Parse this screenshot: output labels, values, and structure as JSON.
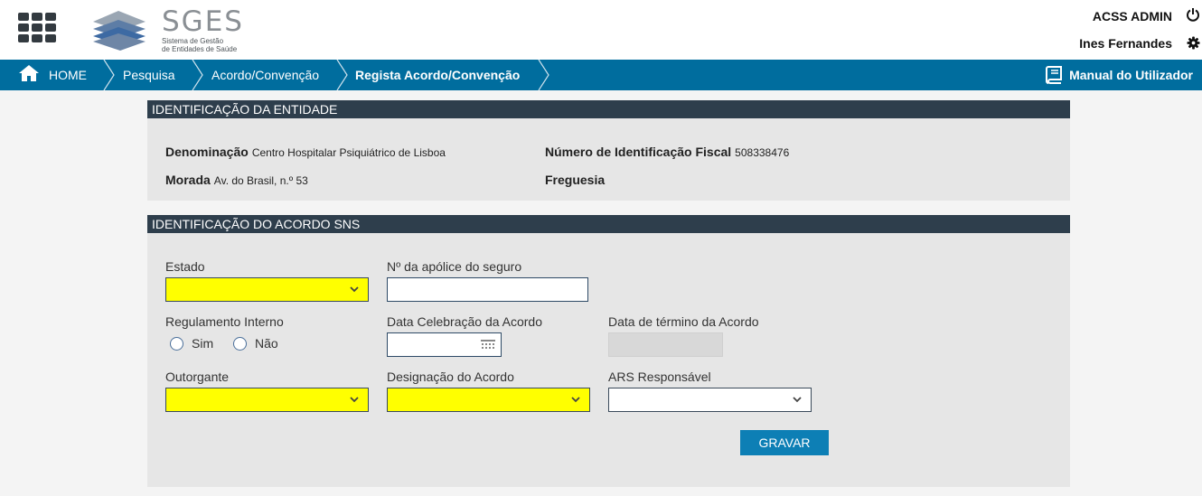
{
  "header": {
    "logo_title": "SGES",
    "logo_subtitle": "Sistema de Gestão\nde Entidades de Saúde",
    "user_role": "ACSS ADMIN",
    "user_name": "Ines Fernandes"
  },
  "breadcrumb": {
    "home": "HOME",
    "items": [
      "Pesquisa",
      "Acordo/Convenção",
      "Regista Acordo/Convenção"
    ],
    "manual": "Manual do Utilizador"
  },
  "entity_panel": {
    "title": "IDENTIFICAÇÃO DA ENTIDADE",
    "denominacao_label": "Denominação",
    "denominacao_value": "Centro Hospitalar Psiquiátrico de Lisboa",
    "nif_label": "Número de Identificação Fiscal",
    "nif_value": "508338476",
    "morada_label": "Morada",
    "morada_value": "Av. do Brasil, n.º 53",
    "freguesia_label": "Freguesia",
    "freguesia_value": ""
  },
  "agreement_panel": {
    "title": "IDENTIFICAÇÃO DO ACORDO SNS",
    "estado_label": "Estado",
    "estado_value": "",
    "apolice_label": "Nº da apólice do seguro",
    "apolice_value": "",
    "regulamento_label": "Regulamento Interno",
    "radio_sim": "Sim",
    "radio_nao": "Não",
    "data_celebracao_label": "Data Celebração da Acordo",
    "data_celebracao_value": "",
    "data_termino_label": "Data de término da Acordo",
    "data_termino_value": "",
    "outorgante_label": "Outorgante",
    "outorgante_value": "",
    "designacao_label": "Designação do Acordo",
    "designacao_value": "",
    "ars_label": "ARS Responsável",
    "ars_value": "",
    "save_button": "GRAVAR"
  },
  "colors": {
    "nav_bg": "#006d9e",
    "panel_header": "#2e3e4c",
    "required_field": "#ffff00",
    "button": "#0d7fb5"
  }
}
